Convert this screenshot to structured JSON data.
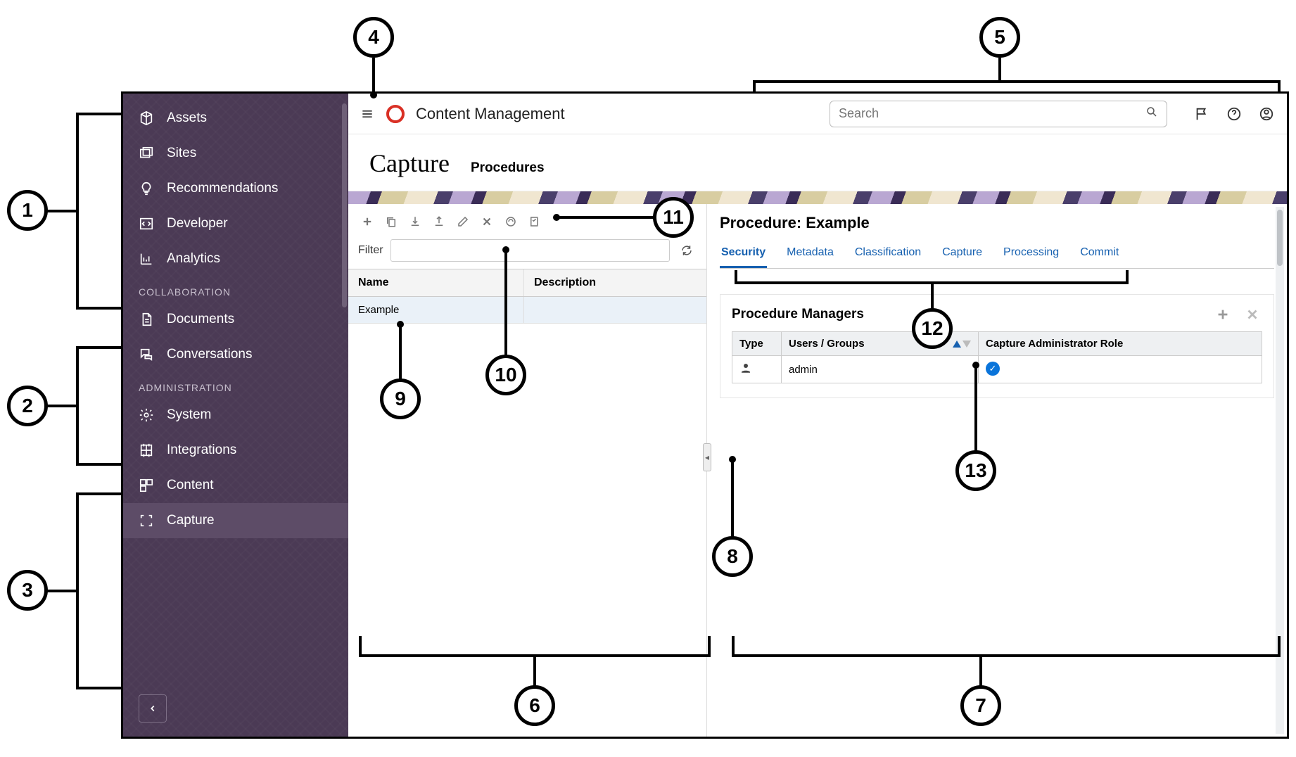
{
  "brand": {
    "title": "Content Management"
  },
  "search": {
    "placeholder": "Search"
  },
  "sidebar": {
    "main": [
      {
        "label": "Assets"
      },
      {
        "label": "Sites"
      },
      {
        "label": "Recommendations"
      },
      {
        "label": "Developer"
      },
      {
        "label": "Analytics"
      }
    ],
    "section_collab": "COLLABORATION",
    "collab": [
      {
        "label": "Documents"
      },
      {
        "label": "Conversations"
      }
    ],
    "section_admin": "ADMINISTRATION",
    "admin": [
      {
        "label": "System"
      },
      {
        "label": "Integrations"
      },
      {
        "label": "Content"
      },
      {
        "label": "Capture"
      }
    ]
  },
  "page": {
    "title": "Capture",
    "crumb": "Procedures"
  },
  "filter": {
    "label": "Filter"
  },
  "proc_table": {
    "col_name": "Name",
    "col_desc": "Description",
    "rows": [
      {
        "name": "Example",
        "desc": ""
      }
    ]
  },
  "right": {
    "title_prefix": "Procedure:",
    "title_name": "Example",
    "tabs": [
      {
        "label": "Security"
      },
      {
        "label": "Metadata"
      },
      {
        "label": "Classification"
      },
      {
        "label": "Capture"
      },
      {
        "label": "Processing"
      },
      {
        "label": "Commit"
      }
    ],
    "managers": {
      "title": "Procedure Managers",
      "col_type": "Type",
      "col_user": "Users / Groups",
      "col_role": "Capture Administrator Role",
      "rows": [
        {
          "type_icon": "person",
          "user": "admin",
          "role_checked": true
        }
      ]
    }
  },
  "callouts": {
    "c1": "1",
    "c2": "2",
    "c3": "3",
    "c4": "4",
    "c5": "5",
    "c6": "6",
    "c7": "7",
    "c8": "8",
    "c9": "9",
    "c10": "10",
    "c11": "11",
    "c12": "12",
    "c13": "13"
  }
}
